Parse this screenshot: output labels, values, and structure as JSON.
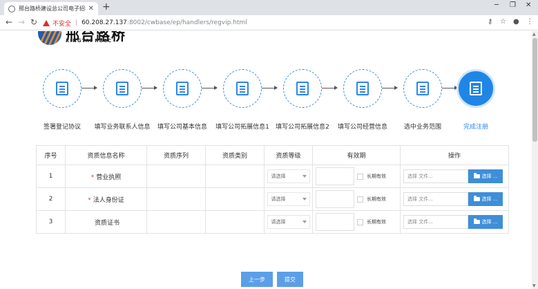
{
  "browser": {
    "tab_title": "邢台路桥建设总公司电子招标采...",
    "insecure_label": "不安全",
    "url_host": "60.208.27.137",
    "url_rest": ":8002/cwbase/ep/handlers/regvip.html"
  },
  "logo": {
    "cn_text": "邢台路桥",
    "en_text": "XINGTAI RBCC"
  },
  "steps": [
    {
      "label": "签署登记协议",
      "icon": "document-sign-icon"
    },
    {
      "label": "填写业务联系人信息",
      "icon": "contact-book-icon"
    },
    {
      "label": "填写公司基本信息",
      "icon": "building-icon"
    },
    {
      "label": "填写公司拓展信息1",
      "icon": "building-icon"
    },
    {
      "label": "填写公司拓展信息2",
      "icon": "building-icon"
    },
    {
      "label": "填写公司经营信息",
      "icon": "chart-board-icon"
    },
    {
      "label": "选中业务范围",
      "icon": "scope-icon"
    },
    {
      "label": "完成注册",
      "icon": "document-check-icon"
    }
  ],
  "table": {
    "headers": [
      "序号",
      "资质信息名称",
      "资质序列",
      "资质类别",
      "资质等级",
      "有效期",
      "操作"
    ],
    "rows": [
      {
        "no": "1",
        "required": "*",
        "name": "营业执照"
      },
      {
        "no": "2",
        "required": "*",
        "name": "法人身份证"
      },
      {
        "no": "3",
        "required": "",
        "name": "资质证书"
      }
    ],
    "select_placeholder": "请选择",
    "long_term_label": "长期有效",
    "file_placeholder": "选择 文件...",
    "file_button_label": "选择 ..."
  },
  "buttons": {
    "prev": "上一步",
    "submit": "提交"
  },
  "colors": {
    "primary": "#3f8ed8",
    "required": "#e53935",
    "insecure": "#d93025"
  }
}
